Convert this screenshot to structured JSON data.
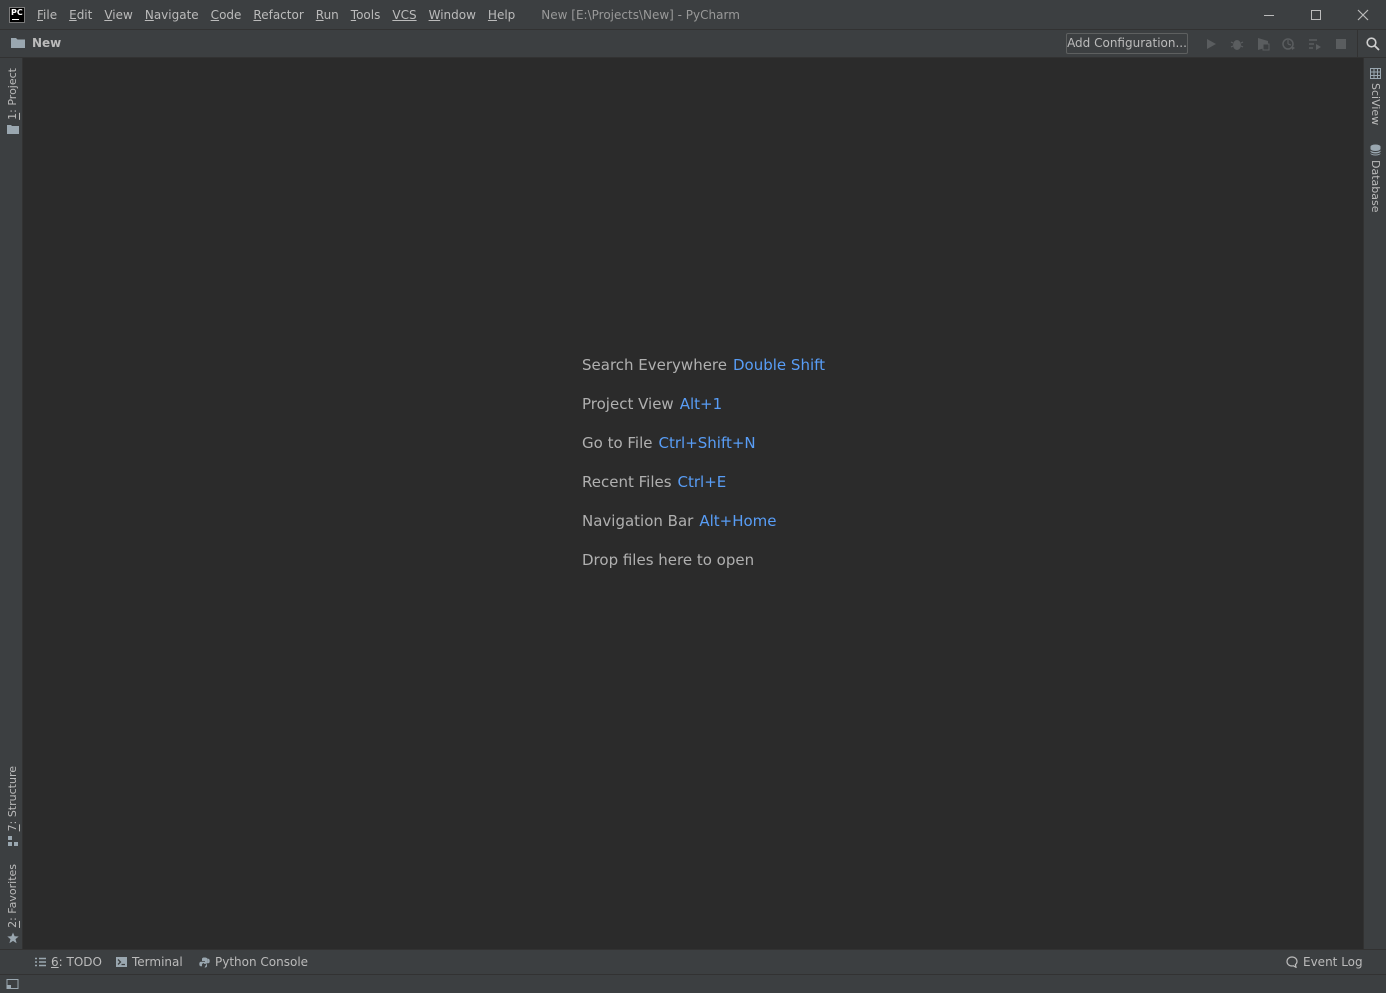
{
  "window": {
    "title": "New [E:\\Projects\\New] - PyCharm",
    "logo_text": "PC"
  },
  "menu": [
    {
      "m": "F",
      "r": "ile"
    },
    {
      "m": "E",
      "r": "dit"
    },
    {
      "m": "V",
      "r": "iew"
    },
    {
      "m": "N",
      "r": "avigate"
    },
    {
      "m": "C",
      "r": "ode"
    },
    {
      "m": "R",
      "r": "efactor"
    },
    {
      "m": "R",
      "r": "un"
    },
    {
      "m": "T",
      "r": "ools"
    },
    {
      "m": "VCS",
      "r": ""
    },
    {
      "m": "W",
      "r": "indow"
    },
    {
      "m": "H",
      "r": "elp"
    }
  ],
  "navbar": {
    "project_name": "New",
    "add_configuration": "Add Configuration..."
  },
  "left_tabs": {
    "project": {
      "m": "1",
      "r": ": Project"
    },
    "structure": {
      "m": "7",
      "r": ": Structure"
    },
    "favorites": {
      "m": "2",
      "r": ": Favorites"
    }
  },
  "right_tabs": {
    "sciview": "SciView",
    "database": "Database"
  },
  "hints": [
    {
      "label": "Search Everywhere",
      "shortcut": "Double Shift"
    },
    {
      "label": "Project View",
      "shortcut": "Alt+1"
    },
    {
      "label": "Go to File",
      "shortcut": "Ctrl+Shift+N"
    },
    {
      "label": "Recent Files",
      "shortcut": "Ctrl+E"
    },
    {
      "label": "Navigation Bar",
      "shortcut": "Alt+Home"
    },
    {
      "label": "Drop files here to open",
      "shortcut": ""
    }
  ],
  "bottom_tabs": {
    "todo": {
      "m": "6",
      "r": ": TODO"
    },
    "terminal": "Terminal",
    "python_console": "Python Console",
    "event_log": "Event Log"
  },
  "colors": {
    "background": "#2b2b2b",
    "chrome": "#3c3f41",
    "shortcut_accent": "#589df6"
  },
  "icons": [
    "pycharm-logo-icon",
    "minimize-icon",
    "maximize-icon",
    "close-icon",
    "folder-icon",
    "run-icon",
    "debug-icon",
    "coverage-icon",
    "profile-icon",
    "concurrency-icon",
    "stop-icon",
    "search-icon",
    "sciview-icon",
    "database-icon",
    "structure-icon",
    "star-icon",
    "todo-icon",
    "terminal-icon",
    "python-console-icon",
    "event-log-icon",
    "tool-window-toggle-icon"
  ]
}
